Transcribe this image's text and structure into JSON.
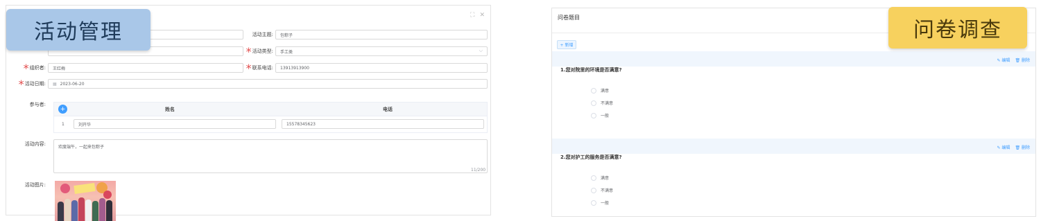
{
  "left": {
    "tag": "活动管理",
    "form": {
      "topic_label": "活动主题:",
      "topic_value": "包粽子",
      "type_label": "活动类型:",
      "type_value": "手工类",
      "organizer_label": "组织者:",
      "organizer_value": "王红梅",
      "phone_label": "联系电话:",
      "phone_value": "13913913900",
      "date_label": "活动日期:",
      "date_value": "2023-06-20",
      "participants_label": "参与者:",
      "content_label": "活动内容:",
      "content_value": "欢度端午，一起来包粽子",
      "content_count": "11/200",
      "photo_label": "活动图片:"
    },
    "participants": {
      "add_label": "+",
      "col_name": "姓名",
      "col_phone": "电话",
      "rows": [
        {
          "index": "1",
          "name": "刘开华",
          "phone": "15578345623"
        }
      ]
    }
  },
  "right": {
    "tag": "问卷调查",
    "title": "问卷题目",
    "new_button": "+ 新增",
    "edit_label": "编辑",
    "delete_label": "删除",
    "questions": [
      {
        "text": "1.您对院里的环境是否满意?",
        "options": [
          "满意",
          "不满意",
          "一般"
        ]
      },
      {
        "text": "2.您对护工的服务是否满意?",
        "options": [
          "满意",
          "不满意",
          "一般"
        ]
      }
    ]
  },
  "icons": {
    "fullscreen": "fullscreen-icon",
    "close": "close-icon",
    "calendar": "calendar-icon",
    "edit": "edit-icon",
    "delete": "delete-icon",
    "chevron": "chevron-down-icon"
  },
  "colors": {
    "left_tag": "#a9c7e8",
    "right_tag": "#f7d15e",
    "primary": "#409eff",
    "required": "#e24b4b"
  }
}
